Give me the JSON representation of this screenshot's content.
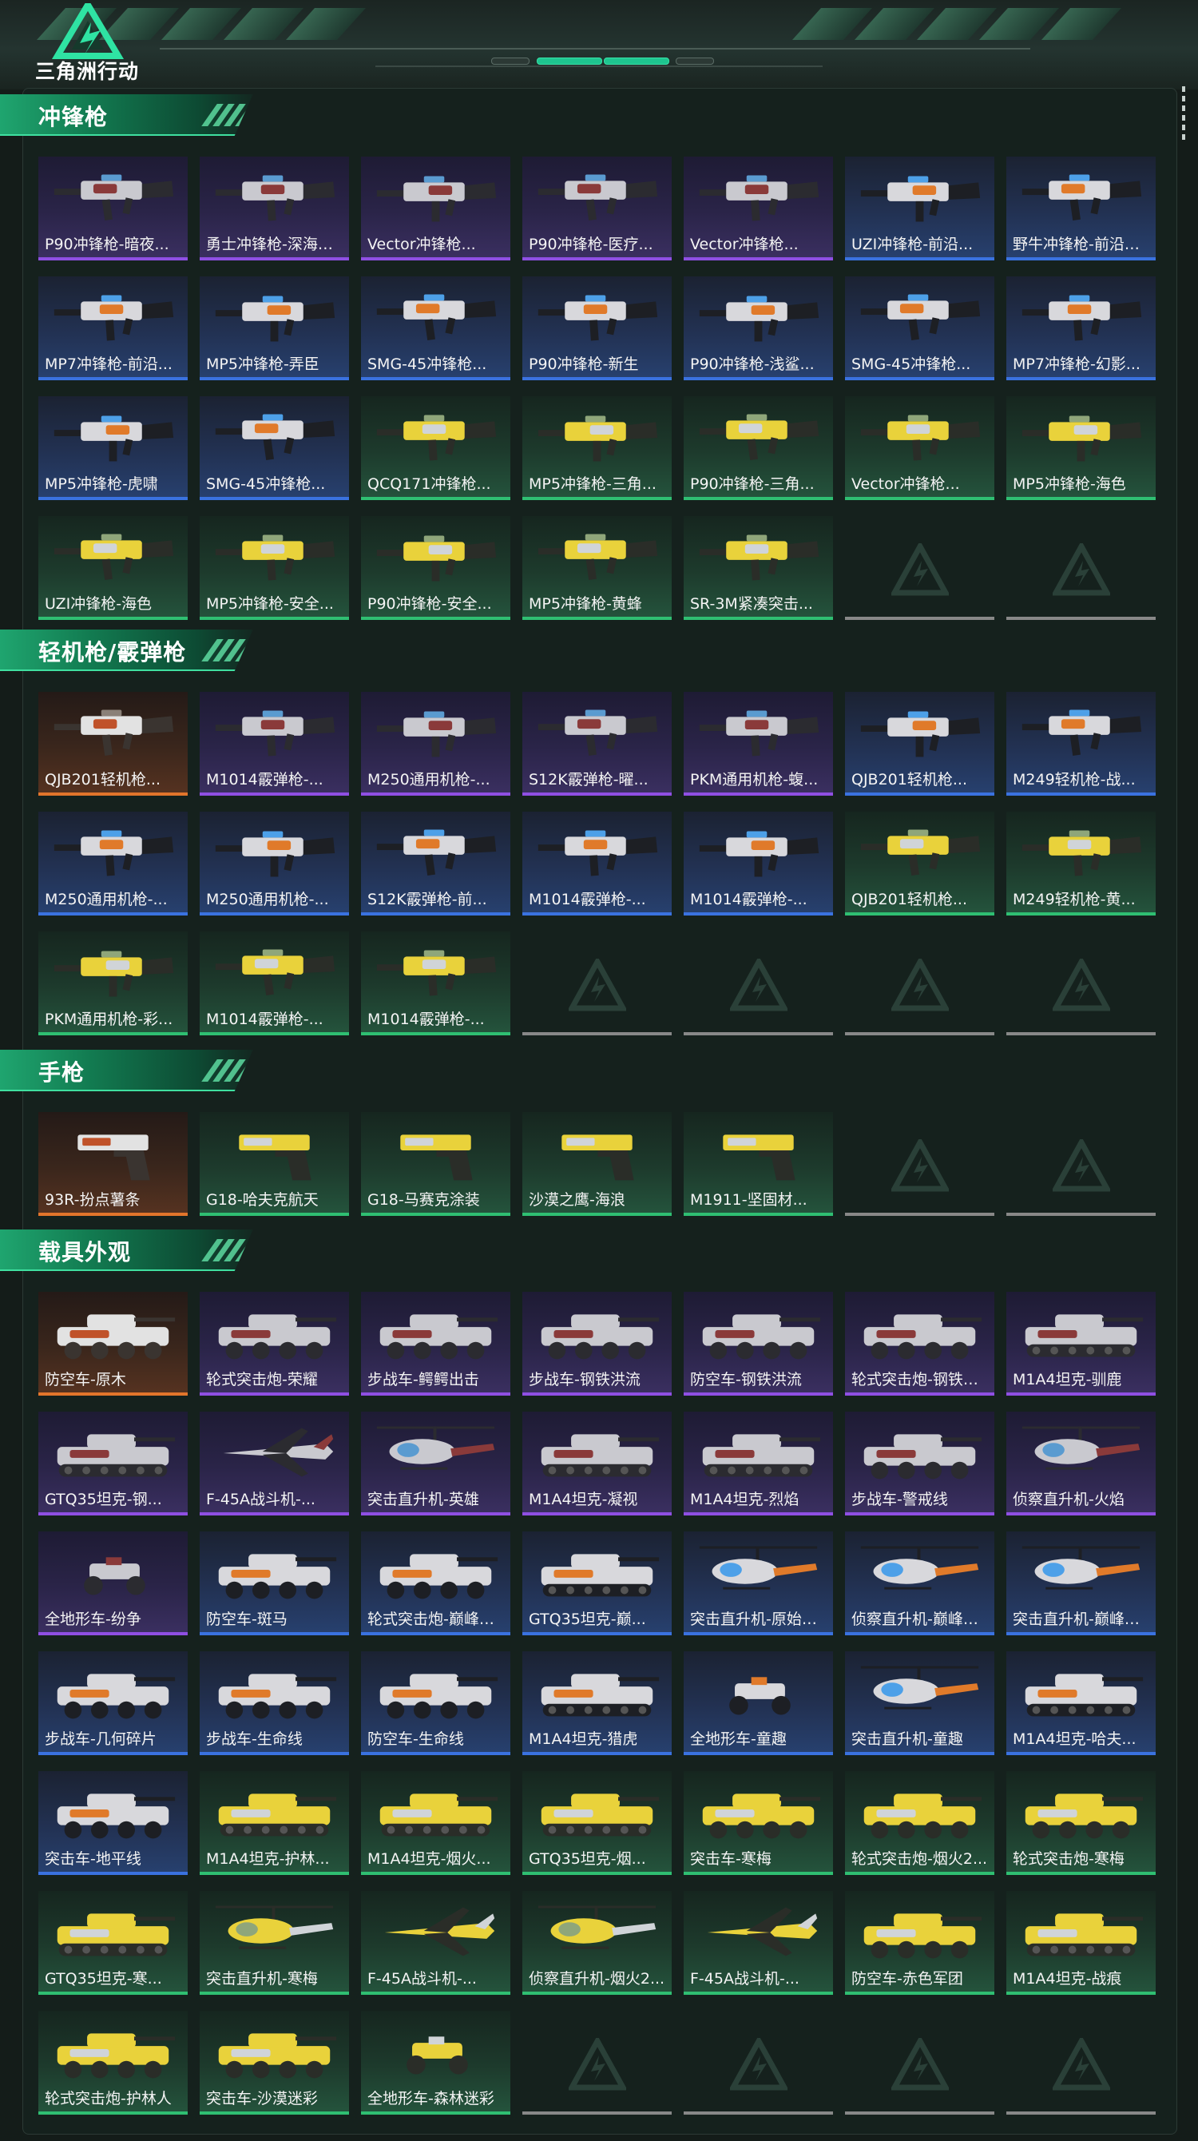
{
  "header": {
    "logo_text": "三角洲行动",
    "logo_icon": "delta-triangle-logo"
  },
  "colors": {
    "accent": "#1ec58f",
    "quality_purple": "#8f4fe3",
    "quality_blue": "#3a72e0",
    "quality_green": "#2fbf72",
    "quality_orange": "#e2752b",
    "empty_slot": "#6b6f6d"
  },
  "sections": [
    {
      "title": "冲锋枪",
      "kind": "weapon",
      "items": [
        {
          "name": "P90冲锋枪-暗夜...",
          "quality": "purple",
          "icon": "p90-smg"
        },
        {
          "name": "勇士冲锋枪-深海恐...",
          "quality": "purple",
          "icon": "warrior-smg"
        },
        {
          "name": "Vector冲锋枪...",
          "quality": "purple",
          "icon": "vector-smg"
        },
        {
          "name": "P90冲锋枪-医疗...",
          "quality": "purple",
          "icon": "p90-smg"
        },
        {
          "name": "Vector冲锋枪...",
          "quality": "purple",
          "icon": "vector-smg"
        },
        {
          "name": "UZI冲锋枪-前沿...",
          "quality": "blue",
          "icon": "uzi-smg"
        },
        {
          "name": "野牛冲锋枪-前沿科...",
          "quality": "blue",
          "icon": "bizon-smg"
        },
        {
          "name": "MP7冲锋枪-前沿...",
          "quality": "blue",
          "icon": "mp7-smg"
        },
        {
          "name": "MP5冲锋枪-弄臣",
          "quality": "blue",
          "icon": "mp5-smg"
        },
        {
          "name": "SMG-45冲锋枪...",
          "quality": "blue",
          "icon": "smg45-smg"
        },
        {
          "name": "P90冲锋枪-新生",
          "quality": "blue",
          "icon": "p90-smg"
        },
        {
          "name": "P90冲锋枪-浅鲨...",
          "quality": "blue",
          "icon": "p90-smg"
        },
        {
          "name": "SMG-45冲锋枪...",
          "quality": "blue",
          "icon": "smg45-smg"
        },
        {
          "name": "MP7冲锋枪-幻影...",
          "quality": "blue",
          "icon": "mp7-smg"
        },
        {
          "name": "MP5冲锋枪-虎啸",
          "quality": "blue",
          "icon": "mp5-smg"
        },
        {
          "name": "SMG-45冲锋枪...",
          "quality": "blue",
          "icon": "smg45-smg"
        },
        {
          "name": "QCQ171冲锋枪...",
          "quality": "green",
          "icon": "qcq171-smg"
        },
        {
          "name": "MP5冲锋枪-三角...",
          "quality": "green",
          "icon": "mp5-smg"
        },
        {
          "name": "P90冲锋枪-三角...",
          "quality": "green",
          "icon": "p90-smg"
        },
        {
          "name": "Vector冲锋枪...",
          "quality": "green",
          "icon": "vector-smg"
        },
        {
          "name": "MP5冲锋枪-海色",
          "quality": "green",
          "icon": "mp5-smg"
        },
        {
          "name": "UZI冲锋枪-海色",
          "quality": "green",
          "icon": "uzi-smg"
        },
        {
          "name": "MP5冲锋枪-安全...",
          "quality": "green",
          "icon": "mp5-smg"
        },
        {
          "name": "P90冲锋枪-安全...",
          "quality": "green",
          "icon": "p90-smg"
        },
        {
          "name": "MP5冲锋枪-黄蜂",
          "quality": "green",
          "icon": "mp5-smg"
        },
        {
          "name": "SR-3M紧凑突击...",
          "quality": "green",
          "icon": "sr3m-rifle"
        },
        {
          "name": "",
          "quality": "empty",
          "icon": "empty-slot"
        },
        {
          "name": "",
          "quality": "empty",
          "icon": "empty-slot"
        }
      ]
    },
    {
      "title": "轻机枪/霰弹枪",
      "kind": "weapon",
      "items": [
        {
          "name": "QJB201轻机枪...",
          "quality": "orange",
          "icon": "qjb201-lmg"
        },
        {
          "name": "M1014霰弹枪-...",
          "quality": "purple",
          "icon": "m1014-shotgun"
        },
        {
          "name": "M250通用机枪-...",
          "quality": "purple",
          "icon": "m250-gpmg"
        },
        {
          "name": "S12K霰弹枪-曜...",
          "quality": "purple",
          "icon": "s12k-shotgun"
        },
        {
          "name": "PKM通用机枪-蝮...",
          "quality": "purple",
          "icon": "pkm-gpmg"
        },
        {
          "name": "QJB201轻机枪...",
          "quality": "blue",
          "icon": "qjb201-lmg"
        },
        {
          "name": "M249轻机枪-战...",
          "quality": "blue",
          "icon": "m249-lmg"
        },
        {
          "name": "M250通用机枪-...",
          "quality": "blue",
          "icon": "m250-gpmg"
        },
        {
          "name": "M250通用机枪-...",
          "quality": "blue",
          "icon": "m250-gpmg"
        },
        {
          "name": "S12K霰弹枪-前...",
          "quality": "blue",
          "icon": "s12k-shotgun"
        },
        {
          "name": "M1014霰弹枪-...",
          "quality": "blue",
          "icon": "m1014-shotgun"
        },
        {
          "name": "M1014霰弹枪-...",
          "quality": "blue",
          "icon": "m1014-shotgun"
        },
        {
          "name": "QJB201轻机枪...",
          "quality": "green",
          "icon": "qjb201-lmg"
        },
        {
          "name": "M249轻机枪-黄...",
          "quality": "green",
          "icon": "m249-lmg"
        },
        {
          "name": "PKM通用机枪-彩...",
          "quality": "green",
          "icon": "pkm-gpmg"
        },
        {
          "name": "M1014霰弹枪-...",
          "quality": "green",
          "icon": "m1014-shotgun"
        },
        {
          "name": "M1014霰弹枪-...",
          "quality": "green",
          "icon": "m1014-shotgun"
        },
        {
          "name": "",
          "quality": "empty",
          "icon": "empty-slot"
        },
        {
          "name": "",
          "quality": "empty",
          "icon": "empty-slot"
        },
        {
          "name": "",
          "quality": "empty",
          "icon": "empty-slot"
        },
        {
          "name": "",
          "quality": "empty",
          "icon": "empty-slot"
        }
      ]
    },
    {
      "title": "手枪",
      "kind": "weapon",
      "items": [
        {
          "name": "93R-扮点薯条",
          "quality": "orange",
          "icon": "93r-pistol"
        },
        {
          "name": "G18-哈夫克航天",
          "quality": "green",
          "icon": "g18-pistol"
        },
        {
          "name": "G18-马赛克涂装",
          "quality": "green",
          "icon": "g18-pistol"
        },
        {
          "name": "沙漠之鹰-海浪",
          "quality": "green",
          "icon": "desert-eagle-pistol"
        },
        {
          "name": "M1911-坚固材...",
          "quality": "green",
          "icon": "m1911-pistol"
        },
        {
          "name": "",
          "quality": "empty",
          "icon": "empty-slot"
        },
        {
          "name": "",
          "quality": "empty",
          "icon": "empty-slot"
        }
      ]
    },
    {
      "title": "载具外观",
      "kind": "vehicle",
      "items": [
        {
          "name": "防空车-原木",
          "quality": "orange",
          "icon": "aa-vehicle"
        },
        {
          "name": "轮式突击炮-荣耀",
          "quality": "purple",
          "icon": "wheeled-assault-gun"
        },
        {
          "name": "步战车-鳄鳄出击",
          "quality": "purple",
          "icon": "ifv"
        },
        {
          "name": "步战车-钢铁洪流",
          "quality": "purple",
          "icon": "ifv"
        },
        {
          "name": "防空车-钢铁洪流",
          "quality": "purple",
          "icon": "aa-vehicle"
        },
        {
          "name": "轮式突击炮-钢铁洪...",
          "quality": "purple",
          "icon": "wheeled-assault-gun"
        },
        {
          "name": "M1A4坦克-驯鹿",
          "quality": "purple",
          "icon": "tank"
        },
        {
          "name": "GTQ35坦克-钢...",
          "quality": "purple",
          "icon": "light-tank"
        },
        {
          "name": "F-45A战斗机-...",
          "quality": "purple",
          "icon": "fighter-jet"
        },
        {
          "name": "突击直升机-英雄",
          "quality": "purple",
          "icon": "attack-helicopter"
        },
        {
          "name": "M1A4坦克-凝视",
          "quality": "purple",
          "icon": "tank"
        },
        {
          "name": "M1A4坦克-烈焰",
          "quality": "purple",
          "icon": "tank"
        },
        {
          "name": "步战车-警戒线",
          "quality": "purple",
          "icon": "ifv"
        },
        {
          "name": "侦察直升机-火焰",
          "quality": "purple",
          "icon": "scout-helicopter"
        },
        {
          "name": "全地形车-纷争",
          "quality": "purple",
          "icon": "atv"
        },
        {
          "name": "防空车-斑马",
          "quality": "blue",
          "icon": "aa-vehicle"
        },
        {
          "name": "轮式突击炮-巅峰竞...",
          "quality": "blue",
          "icon": "wheeled-assault-gun"
        },
        {
          "name": "GTQ35坦克-巅...",
          "quality": "blue",
          "icon": "light-tank"
        },
        {
          "name": "突击直升机-原始伪...",
          "quality": "blue",
          "icon": "attack-helicopter"
        },
        {
          "name": "侦察直升机-巅峰竞...",
          "quality": "blue",
          "icon": "scout-helicopter"
        },
        {
          "name": "突击直升机-巅峰竞...",
          "quality": "blue",
          "icon": "attack-helicopter"
        },
        {
          "name": "步战车-几何碎片",
          "quality": "blue",
          "icon": "ifv"
        },
        {
          "name": "步战车-生命线",
          "quality": "blue",
          "icon": "ifv"
        },
        {
          "name": "防空车-生命线",
          "quality": "blue",
          "icon": "aa-vehicle"
        },
        {
          "name": "M1A4坦克-猎虎",
          "quality": "blue",
          "icon": "tank"
        },
        {
          "name": "全地形车-童趣",
          "quality": "blue",
          "icon": "atv"
        },
        {
          "name": "突击直升机-童趣",
          "quality": "blue",
          "icon": "attack-helicopter"
        },
        {
          "name": "M1A4坦克-哈夫...",
          "quality": "blue",
          "icon": "tank"
        },
        {
          "name": "突击车-地平线",
          "quality": "blue",
          "icon": "assault-car"
        },
        {
          "name": "M1A4坦克-护林...",
          "quality": "green",
          "icon": "tank"
        },
        {
          "name": "M1A4坦克-烟火...",
          "quality": "green",
          "icon": "tank"
        },
        {
          "name": "GTQ35坦克-烟...",
          "quality": "green",
          "icon": "light-tank"
        },
        {
          "name": "突击车-寒梅",
          "quality": "green",
          "icon": "assault-car"
        },
        {
          "name": "轮式突击炮-烟火2...",
          "quality": "green",
          "icon": "wheeled-assault-gun"
        },
        {
          "name": "轮式突击炮-寒梅",
          "quality": "green",
          "icon": "wheeled-assault-gun"
        },
        {
          "name": "GTQ35坦克-寒...",
          "quality": "green",
          "icon": "light-tank"
        },
        {
          "name": "突击直升机-寒梅",
          "quality": "green",
          "icon": "attack-helicopter"
        },
        {
          "name": "F-45A战斗机-...",
          "quality": "green",
          "icon": "fighter-jet"
        },
        {
          "name": "侦察直升机-烟火2...",
          "quality": "green",
          "icon": "scout-helicopter"
        },
        {
          "name": "F-45A战斗机-...",
          "quality": "green",
          "icon": "fighter-jet"
        },
        {
          "name": "防空车-赤色军团",
          "quality": "green",
          "icon": "aa-vehicle"
        },
        {
          "name": "M1A4坦克-战痕",
          "quality": "green",
          "icon": "tank"
        },
        {
          "name": "轮式突击炮-护林人",
          "quality": "green",
          "icon": "wheeled-assault-gun"
        },
        {
          "name": "突击车-沙漠迷彩",
          "quality": "green",
          "icon": "assault-car"
        },
        {
          "name": "全地形车-森林迷彩",
          "quality": "green",
          "icon": "atv"
        },
        {
          "name": "",
          "quality": "empty",
          "icon": "empty-slot"
        },
        {
          "name": "",
          "quality": "empty",
          "icon": "empty-slot"
        },
        {
          "name": "",
          "quality": "empty",
          "icon": "empty-slot"
        },
        {
          "name": "",
          "quality": "empty",
          "icon": "empty-slot"
        }
      ]
    }
  ]
}
